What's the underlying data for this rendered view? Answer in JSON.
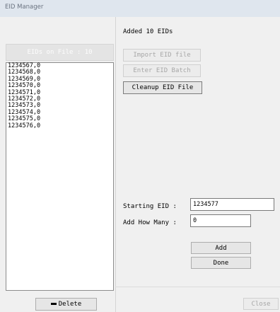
{
  "window": {
    "title": "EID Manager"
  },
  "status_message": "Added 10 EIDs",
  "left": {
    "header": "EIDs on File : 10",
    "eids": [
      "1234567,0",
      "1234568,0",
      "1234569,0",
      "1234570,0",
      "1234571,0",
      "1234572,0",
      "1234573,0",
      "1234574,0",
      "1234575,0",
      "1234576,0"
    ],
    "delete_label": "Delete"
  },
  "buttons": {
    "import": "Import EID file",
    "enter_batch": "Enter EID Batch",
    "cleanup": "Cleanup EID File",
    "add": "Add",
    "done": "Done",
    "close": "Close"
  },
  "form": {
    "starting_eid_label": "Starting EID :",
    "starting_eid_value": "1234577",
    "add_how_many_label": "Add How Many :",
    "add_how_many_value": "0"
  }
}
